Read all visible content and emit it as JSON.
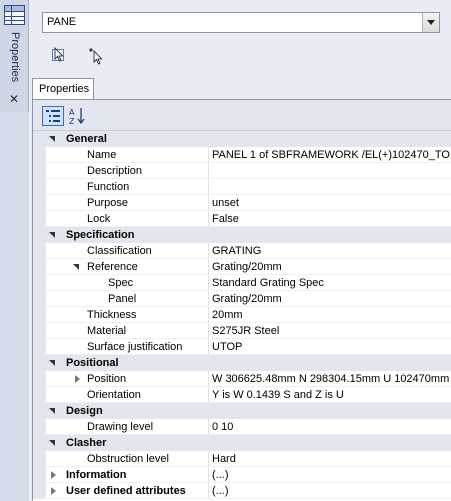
{
  "dock": {
    "label": "Properties"
  },
  "selector": {
    "value": "PANE"
  },
  "tab": {
    "label": "Properties"
  },
  "grid": {
    "rows": [
      {
        "type": "category",
        "state": "expanded",
        "label": "General"
      },
      {
        "type": "prop",
        "label": "Name",
        "value": "PANEL 1 of SBFRAMEWORK /EL(+)102470_TO"
      },
      {
        "type": "prop",
        "label": "Description",
        "value": ""
      },
      {
        "type": "prop",
        "label": "Function",
        "value": ""
      },
      {
        "type": "prop",
        "label": "Purpose",
        "value": "unset"
      },
      {
        "type": "prop",
        "label": "Lock",
        "value": "False"
      },
      {
        "type": "category",
        "state": "expanded",
        "label": "Specification"
      },
      {
        "type": "prop",
        "label": "Classification",
        "value": "GRATING"
      },
      {
        "type": "prop",
        "label": "Reference",
        "value": "Grating/20mm",
        "toggle": "expanded"
      },
      {
        "type": "prop",
        "label": "Spec",
        "value": "Standard Grating Spec",
        "sub": true
      },
      {
        "type": "prop",
        "label": "Panel",
        "value": "Grating/20mm",
        "sub": true
      },
      {
        "type": "prop",
        "label": "Thickness",
        "value": "20mm"
      },
      {
        "type": "prop",
        "label": "Material",
        "value": "S275JR Steel"
      },
      {
        "type": "prop",
        "label": "Surface justification",
        "value": "UTOP"
      },
      {
        "type": "category",
        "state": "expanded",
        "label": "Positional"
      },
      {
        "type": "prop",
        "label": "Position",
        "value": "W 306625.48mm N 298304.15mm U 102470mm",
        "toggle": "collapsed"
      },
      {
        "type": "prop",
        "label": "Orientation",
        "value": "Y is W 0.1439 S and Z is U"
      },
      {
        "type": "category",
        "state": "expanded",
        "label": "Design"
      },
      {
        "type": "prop",
        "label": "Drawing level",
        "value": "0 10"
      },
      {
        "type": "category",
        "state": "expanded",
        "label": "Clasher"
      },
      {
        "type": "prop",
        "label": "Obstruction level",
        "value": "Hard"
      },
      {
        "type": "category",
        "state": "collapsed",
        "label": "Information",
        "value": "(...)"
      },
      {
        "type": "category",
        "state": "collapsed",
        "label": "User defined attributes",
        "value": "(...)"
      }
    ]
  }
}
